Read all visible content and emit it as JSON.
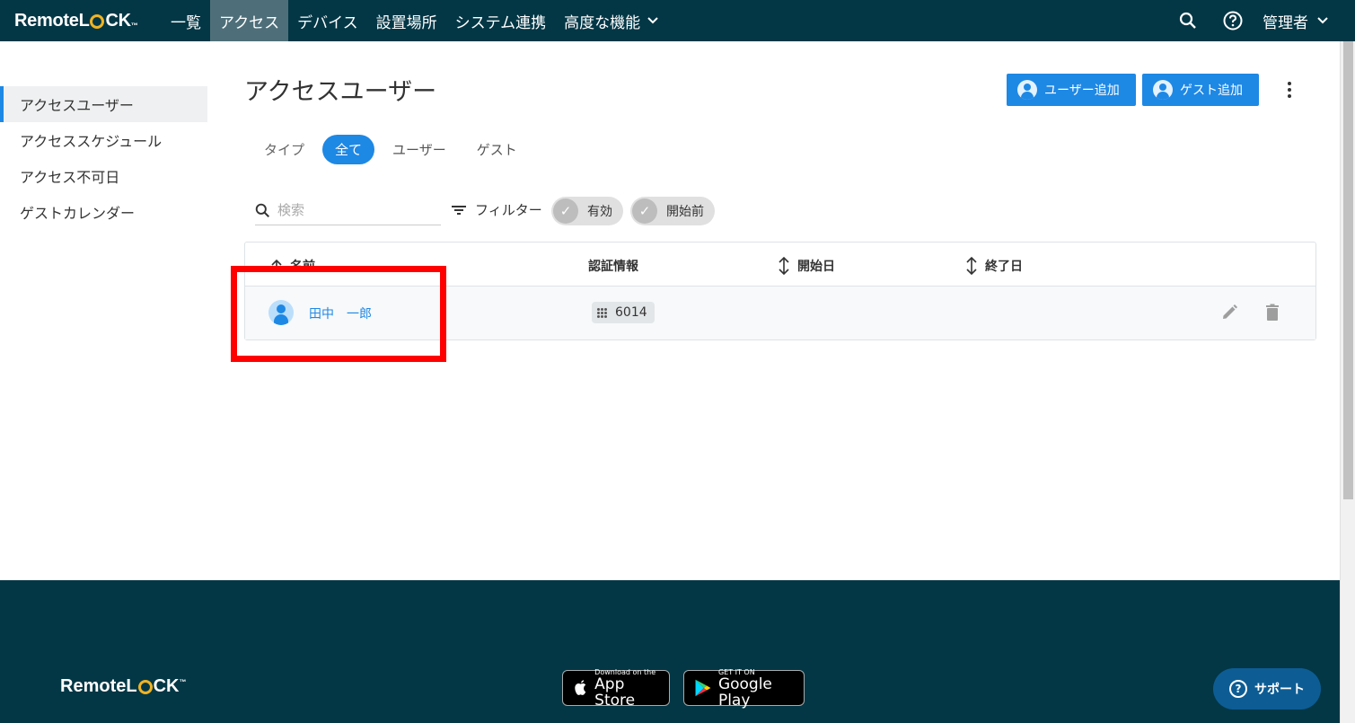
{
  "brand": {
    "name_left": "Remote",
    "name_right": "L",
    "name_tail": "CK",
    "tm": "™"
  },
  "nav": {
    "items": [
      {
        "label": "一覧"
      },
      {
        "label": "アクセス"
      },
      {
        "label": "デバイス"
      },
      {
        "label": "設置場所"
      },
      {
        "label": "システム連携"
      },
      {
        "label": "高度な機能"
      }
    ],
    "admin_label": "管理者"
  },
  "sidebar": {
    "items": [
      {
        "label": "アクセスユーザー"
      },
      {
        "label": "アクセススケジュール"
      },
      {
        "label": "アクセス不可日"
      },
      {
        "label": "ゲストカレンダー"
      }
    ]
  },
  "page": {
    "title": "アクセスユーザー",
    "add_user_label": "ユーザー追加",
    "add_guest_label": "ゲスト追加"
  },
  "tabs": {
    "type_label": "タイプ",
    "items": [
      {
        "label": "全て"
      },
      {
        "label": "ユーザー"
      },
      {
        "label": "ゲスト"
      }
    ]
  },
  "search": {
    "placeholder": "検索",
    "value": ""
  },
  "filter": {
    "label": "フィルター",
    "chips": [
      {
        "label": "有効"
      },
      {
        "label": "開始前"
      }
    ]
  },
  "table": {
    "columns": [
      {
        "label": "名前"
      },
      {
        "label": "認証情報"
      },
      {
        "label": "開始日"
      },
      {
        "label": "終了日"
      }
    ],
    "rows": [
      {
        "name": "田中　一郎",
        "credential": "6014",
        "start": "",
        "end": ""
      }
    ]
  },
  "footer": {
    "app_store_small": "Download on the",
    "app_store_big": "App Store",
    "google_small": "GET IT ON",
    "google_big": "Google Play",
    "support_label": "サポート"
  },
  "colors": {
    "nav_bg": "#033746",
    "accent": "#1e88e5",
    "highlight": "#ff0000",
    "lock_yellow": "#f0b323"
  }
}
